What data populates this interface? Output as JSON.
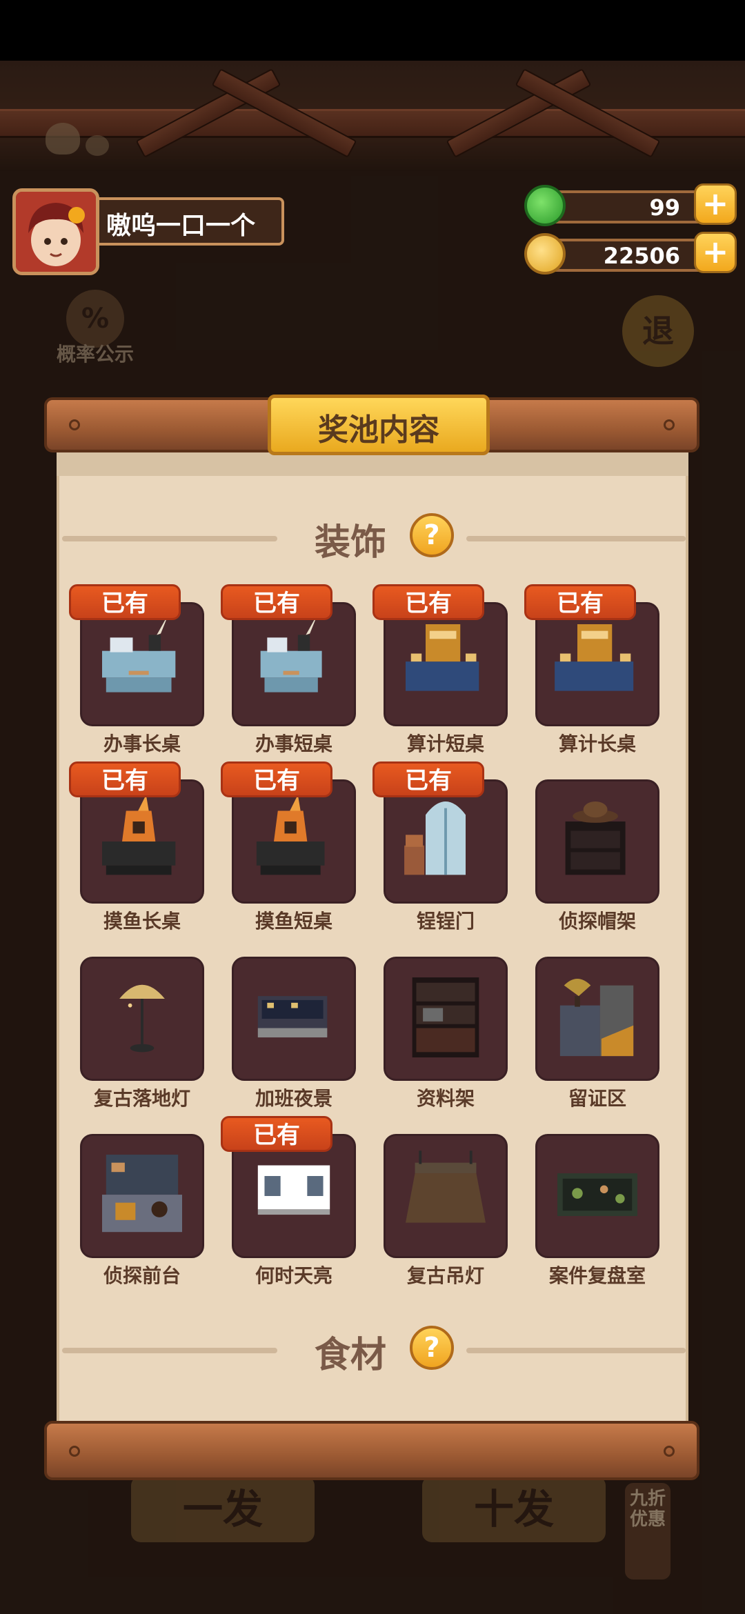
{
  "player": {
    "name": "嗷呜一口一个"
  },
  "currency": [
    {
      "name": "jade",
      "value": "99",
      "icon": "jade-coin-icon"
    },
    {
      "name": "coin",
      "value": "22506",
      "icon": "gold-coin-icon"
    }
  ],
  "background": {
    "probability_label": "概率公示",
    "probability_icon_text": "%",
    "back_label": "退",
    "draw_one": "一发",
    "draw_ten": "十发",
    "discount": "九折优惠"
  },
  "panel": {
    "title": "奖池内容",
    "sections": [
      {
        "title": "装饰",
        "help": "?"
      },
      {
        "title": "食材",
        "help": "?"
      }
    ],
    "owned_badge": "已有",
    "items": [
      {
        "label": "办事长桌",
        "owned": true,
        "icon": "office-long-desk-icon"
      },
      {
        "label": "办事短桌",
        "owned": true,
        "icon": "office-short-desk-icon"
      },
      {
        "label": "算计短桌",
        "owned": true,
        "icon": "accounting-short-desk-icon"
      },
      {
        "label": "算计长桌",
        "owned": true,
        "icon": "accounting-long-desk-icon"
      },
      {
        "label": "摸鱼长桌",
        "owned": true,
        "icon": "slacker-long-desk-icon"
      },
      {
        "label": "摸鱼短桌",
        "owned": true,
        "icon": "slacker-short-desk-icon"
      },
      {
        "label": "锃锃门",
        "owned": true,
        "icon": "shiny-door-icon"
      },
      {
        "label": "侦探帽架",
        "owned": false,
        "icon": "detective-hat-rack-icon"
      },
      {
        "label": "复古落地灯",
        "owned": false,
        "icon": "retro-floor-lamp-icon"
      },
      {
        "label": "加班夜景",
        "owned": false,
        "icon": "overtime-night-view-icon"
      },
      {
        "label": "资料架",
        "owned": false,
        "icon": "document-shelf-icon"
      },
      {
        "label": "留证区",
        "owned": false,
        "icon": "evidence-area-icon"
      },
      {
        "label": "侦探前台",
        "owned": false,
        "icon": "detective-front-desk-icon"
      },
      {
        "label": "何时天亮",
        "owned": true,
        "icon": "dawn-window-icon"
      },
      {
        "label": "复古吊灯",
        "owned": false,
        "icon": "retro-pendant-lamp-icon"
      },
      {
        "label": "案件复盘室",
        "owned": false,
        "icon": "case-review-room-icon"
      }
    ]
  },
  "colors": {
    "badge": "#d84e1c",
    "cell": "#4a2a2e",
    "paper": "#ead7bd",
    "gold": "#f5b82a"
  }
}
